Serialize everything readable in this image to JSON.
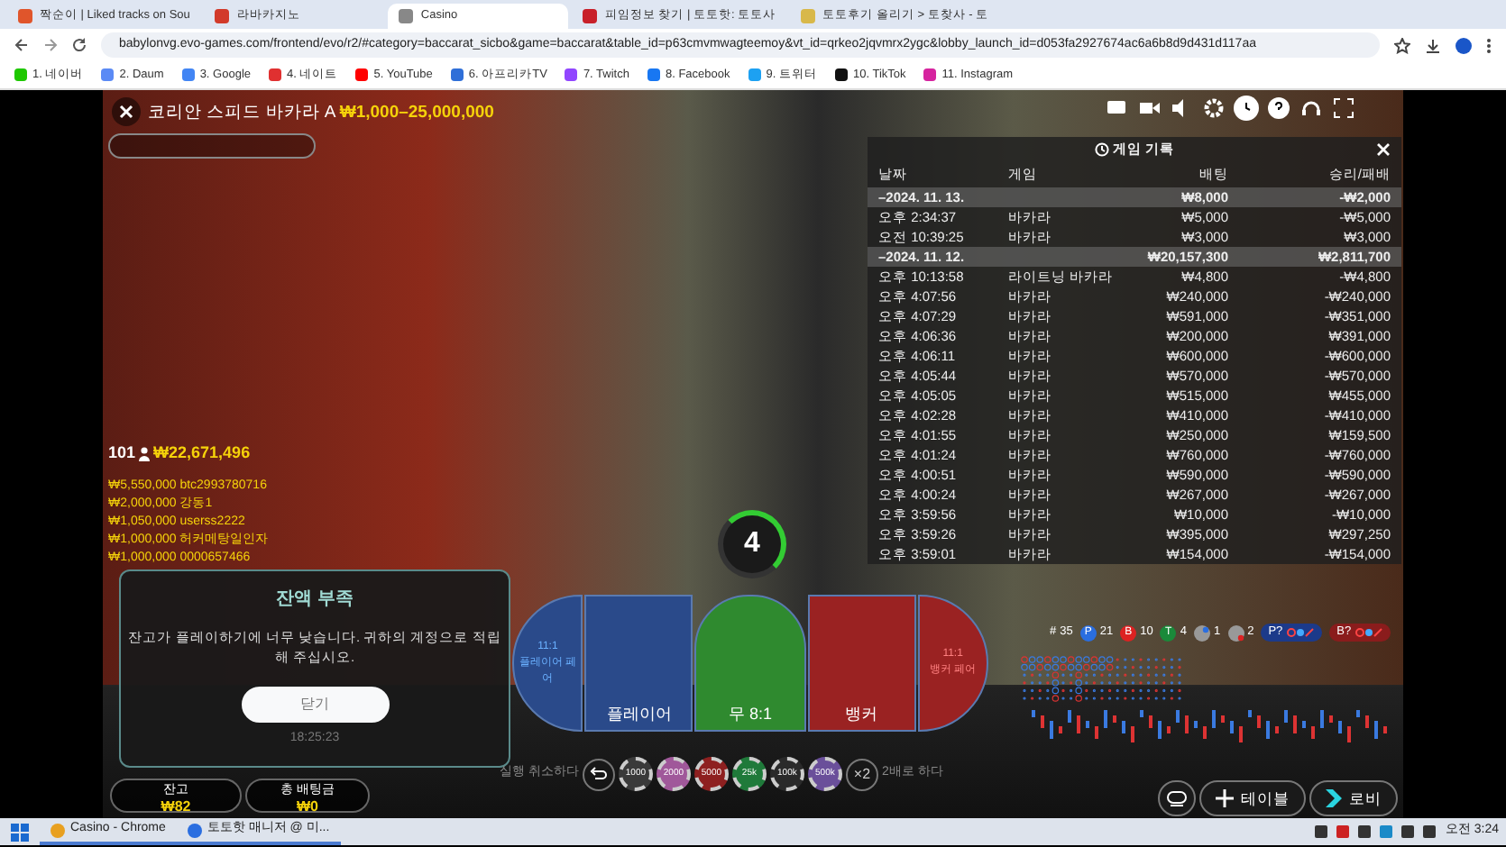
{
  "browser": {
    "tabs": [
      {
        "title": "짝순이 | Liked tracks on Sou",
        "selected": false
      },
      {
        "title": "라바카지노",
        "selected": false
      },
      {
        "title": "Casino",
        "selected": true
      },
      {
        "title": "피임정보 찾기 | 토토핫: 토토사",
        "selected": false
      },
      {
        "title": "토토후기 올리기 > 토찾사 - 토",
        "selected": false
      }
    ],
    "url": "babylonvg.evo-games.com/frontend/evo/r2/#category=baccarat_sicbo&game=baccarat&table_id=p63cmvmwagteemoy&vt_id=qrkeo2jqvmrx2ygc&lobby_launch_id=d053fa2927674ac6a6b8d9d431d117aa",
    "bookmarks": [
      "1. 네이버",
      "2. Daum",
      "3. Google",
      "4. 네이트",
      "5. YouTube",
      "6. 아프리카TV",
      "7. Twitch",
      "8. Facebook",
      "9. 트위터",
      "10. TikTok",
      "11. Instagram"
    ]
  },
  "game": {
    "title": "코리안 스피드 바카라 A",
    "limits": "₩1,000–25,000,000",
    "players": "101",
    "total_bet": "₩22,671,496",
    "winners": [
      {
        "amount": "₩5,550,000",
        "name": "btc2993780716"
      },
      {
        "amount": "₩2,000,000",
        "name": "강동1"
      },
      {
        "amount": "₩1,050,000",
        "name": "userss2222"
      },
      {
        "amount": "₩1,000,000",
        "name": "허커메탕일인자"
      },
      {
        "amount": "₩1,000,000",
        "name": "0000657466"
      }
    ],
    "timer": "4",
    "history": {
      "title": "게임 기록",
      "columns": [
        "날짜",
        "게임",
        "배팅",
        "승리/패배"
      ],
      "rows": [
        {
          "kind": "date",
          "date": "–2024. 11. 13.",
          "bet": "₩8,000",
          "result": "-₩2,000"
        },
        {
          "kind": "entry",
          "time": "오후 2:34:37",
          "game": "바카라",
          "bet": "₩5,000",
          "result": "-₩5,000"
        },
        {
          "kind": "entry",
          "time": "오전 10:39:25",
          "game": "바카라",
          "bet": "₩3,000",
          "result": "₩3,000"
        },
        {
          "kind": "date",
          "date": "–2024. 11. 12.",
          "bet": "₩20,157,300",
          "result": "₩2,811,700"
        },
        {
          "kind": "entry",
          "time": "오후 10:13:58",
          "game": "라이트닝 바카라",
          "bet": "₩4,800",
          "result": "-₩4,800"
        },
        {
          "kind": "entry",
          "time": "오후 4:07:56",
          "game": "바카라",
          "bet": "₩240,000",
          "result": "-₩240,000"
        },
        {
          "kind": "entry",
          "time": "오후 4:07:29",
          "game": "바카라",
          "bet": "₩591,000",
          "result": "-₩351,000"
        },
        {
          "kind": "entry",
          "time": "오후 4:06:36",
          "game": "바카라",
          "bet": "₩200,000",
          "result": "₩391,000"
        },
        {
          "kind": "entry",
          "time": "오후 4:06:11",
          "game": "바카라",
          "bet": "₩600,000",
          "result": "-₩600,000"
        },
        {
          "kind": "entry",
          "time": "오후 4:05:44",
          "game": "바카라",
          "bet": "₩570,000",
          "result": "-₩570,000"
        },
        {
          "kind": "entry",
          "time": "오후 4:05:05",
          "game": "바카라",
          "bet": "₩515,000",
          "result": "₩455,000"
        },
        {
          "kind": "entry",
          "time": "오후 4:02:28",
          "game": "바카라",
          "bet": "₩410,000",
          "result": "-₩410,000"
        },
        {
          "kind": "entry",
          "time": "오후 4:01:55",
          "game": "바카라",
          "bet": "₩250,000",
          "result": "₩159,500"
        },
        {
          "kind": "entry",
          "time": "오후 4:01:24",
          "game": "바카라",
          "bet": "₩760,000",
          "result": "-₩760,000"
        },
        {
          "kind": "entry",
          "time": "오후 4:00:51",
          "game": "바카라",
          "bet": "₩590,000",
          "result": "-₩590,000"
        },
        {
          "kind": "entry",
          "time": "오후 4:00:24",
          "game": "바카라",
          "bet": "₩267,000",
          "result": "-₩267,000"
        },
        {
          "kind": "entry",
          "time": "오후 3:59:56",
          "game": "바카라",
          "bet": "₩10,000",
          "result": "-₩10,000"
        },
        {
          "kind": "entry",
          "time": "오후 3:59:26",
          "game": "바카라",
          "bet": "₩395,000",
          "result": "₩297,250"
        },
        {
          "kind": "entry",
          "time": "오후 3:59:01",
          "game": "바카라",
          "bet": "₩154,000",
          "result": "-₩154,000"
        }
      ]
    },
    "modal": {
      "title": "잔액 부족",
      "message": "잔고가 플레이하기에 너무 낮습니다. 귀하의 계정으로 적립해 주십시오.",
      "button": "닫기",
      "time": "18:25:23"
    },
    "balances": [
      {
        "label": "잔고",
        "value": "₩82"
      },
      {
        "label": "총 배팅금",
        "value": "₩0"
      }
    ],
    "bets": [
      {
        "kind": "player_pair",
        "odds": "11:1",
        "label": "플레이어 페어"
      },
      {
        "kind": "player",
        "label": "플레이어"
      },
      {
        "kind": "tie",
        "label": "무 8:1"
      },
      {
        "kind": "banker",
        "label": "뱅커"
      },
      {
        "kind": "banker_pair",
        "odds": "11:1",
        "label": "뱅커 페어"
      }
    ],
    "undo_label": "실행 취소하다",
    "chips": [
      {
        "label": "1000",
        "color": "#3a3a3a"
      },
      {
        "label": "2000",
        "color": "#a0589a"
      },
      {
        "label": "5000",
        "color": "#8e2020"
      },
      {
        "label": "25k",
        "color": "#1f7a3a"
      },
      {
        "label": "100k",
        "color": "#2a2a2a"
      },
      {
        "label": "500k",
        "color": "#6a4f9a"
      }
    ],
    "double": "×2",
    "double_label": "2배로 하다",
    "stats": [
      {
        "kind": "total",
        "label": "#",
        "value": "35"
      },
      {
        "kind": "player",
        "label": "P",
        "value": "21"
      },
      {
        "kind": "banker",
        "label": "B",
        "value": "10"
      },
      {
        "kind": "tie",
        "label": "T",
        "value": "4"
      },
      {
        "kind": "player_pair",
        "value": "1"
      },
      {
        "kind": "banker_pair",
        "value": "2"
      }
    ],
    "predict": [
      {
        "kind": "player",
        "label": "P?"
      },
      {
        "kind": "banker",
        "label": "B?"
      }
    ],
    "buttons": [
      {
        "kind": "table",
        "label": "테이블"
      },
      {
        "kind": "lobby",
        "label": "로비"
      }
    ]
  },
  "taskbar": {
    "items": [
      "Casino - Chrome",
      "토토핫 매니저 @ 미..."
    ],
    "clock": "오전 3:24"
  }
}
